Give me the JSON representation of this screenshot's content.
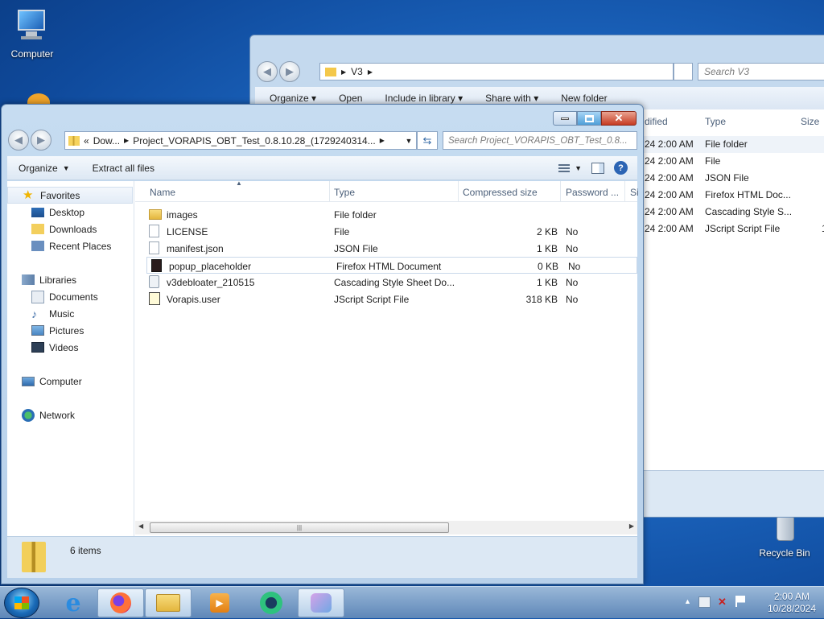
{
  "desktop": {
    "computer_label": "Computer",
    "recycle_label": "Recycle Bin"
  },
  "back_window": {
    "path_segment": "V3",
    "search_placeholder": "Search V3",
    "toolbar": {
      "organize": "Organize",
      "open": "Open",
      "include": "Include in library",
      "share": "Share with",
      "new_folder": "New folder"
    },
    "headers": {
      "modified": "dified",
      "type": "Type",
      "size": "Size"
    },
    "rows": [
      {
        "modified": "24 2:00 AM",
        "type": "File folder",
        "size": ""
      },
      {
        "modified": "24 2:00 AM",
        "type": "File",
        "size": ""
      },
      {
        "modified": "24 2:00 AM",
        "type": "JSON File",
        "size": ""
      },
      {
        "modified": "24 2:00 AM",
        "type": "Firefox HTML Doc...",
        "size": ""
      },
      {
        "modified": "24 2:00 AM",
        "type": "Cascading Style S...",
        "size": ""
      },
      {
        "modified": "24 2:00 AM",
        "type": "JScript Script File",
        "size": "1,"
      }
    ]
  },
  "window": {
    "address": {
      "prefix": "«",
      "seg1": "Dow...",
      "seg2": "Project_VORAPIS_OBT_Test_0.8.10.28_(1729240314..."
    },
    "search_placeholder": "Search Project_VORAPIS_OBT_Test_0.8...",
    "toolbar": {
      "organize": "Organize",
      "extract": "Extract all files"
    },
    "nav": {
      "favorites": "Favorites",
      "desktop": "Desktop",
      "downloads": "Downloads",
      "recent": "Recent Places",
      "libraries": "Libraries",
      "documents": "Documents",
      "music": "Music",
      "pictures": "Pictures",
      "videos": "Videos",
      "computer": "Computer",
      "network": "Network"
    },
    "columns": {
      "name": "Name",
      "type": "Type",
      "compressed": "Compressed size",
      "password": "Password ...",
      "size": "Si"
    },
    "files": [
      {
        "name": "images",
        "type": "File folder",
        "compressed": "",
        "password": ""
      },
      {
        "name": "LICENSE",
        "type": "File",
        "compressed": "2 KB",
        "password": "No"
      },
      {
        "name": "manifest.json",
        "type": "JSON File",
        "compressed": "1 KB",
        "password": "No"
      },
      {
        "name": "popup_placeholder",
        "type": "Firefox HTML Document",
        "compressed": "0 KB",
        "password": "No"
      },
      {
        "name": "v3debloater_210515",
        "type": "Cascading Style Sheet Do...",
        "compressed": "1 KB",
        "password": "No"
      },
      {
        "name": "Vorapis.user",
        "type": "JScript Script File",
        "compressed": "318 KB",
        "password": "No"
      }
    ],
    "status": "6 items"
  },
  "taskbar": {
    "time": "2:00 AM",
    "date": "10/28/2024"
  }
}
